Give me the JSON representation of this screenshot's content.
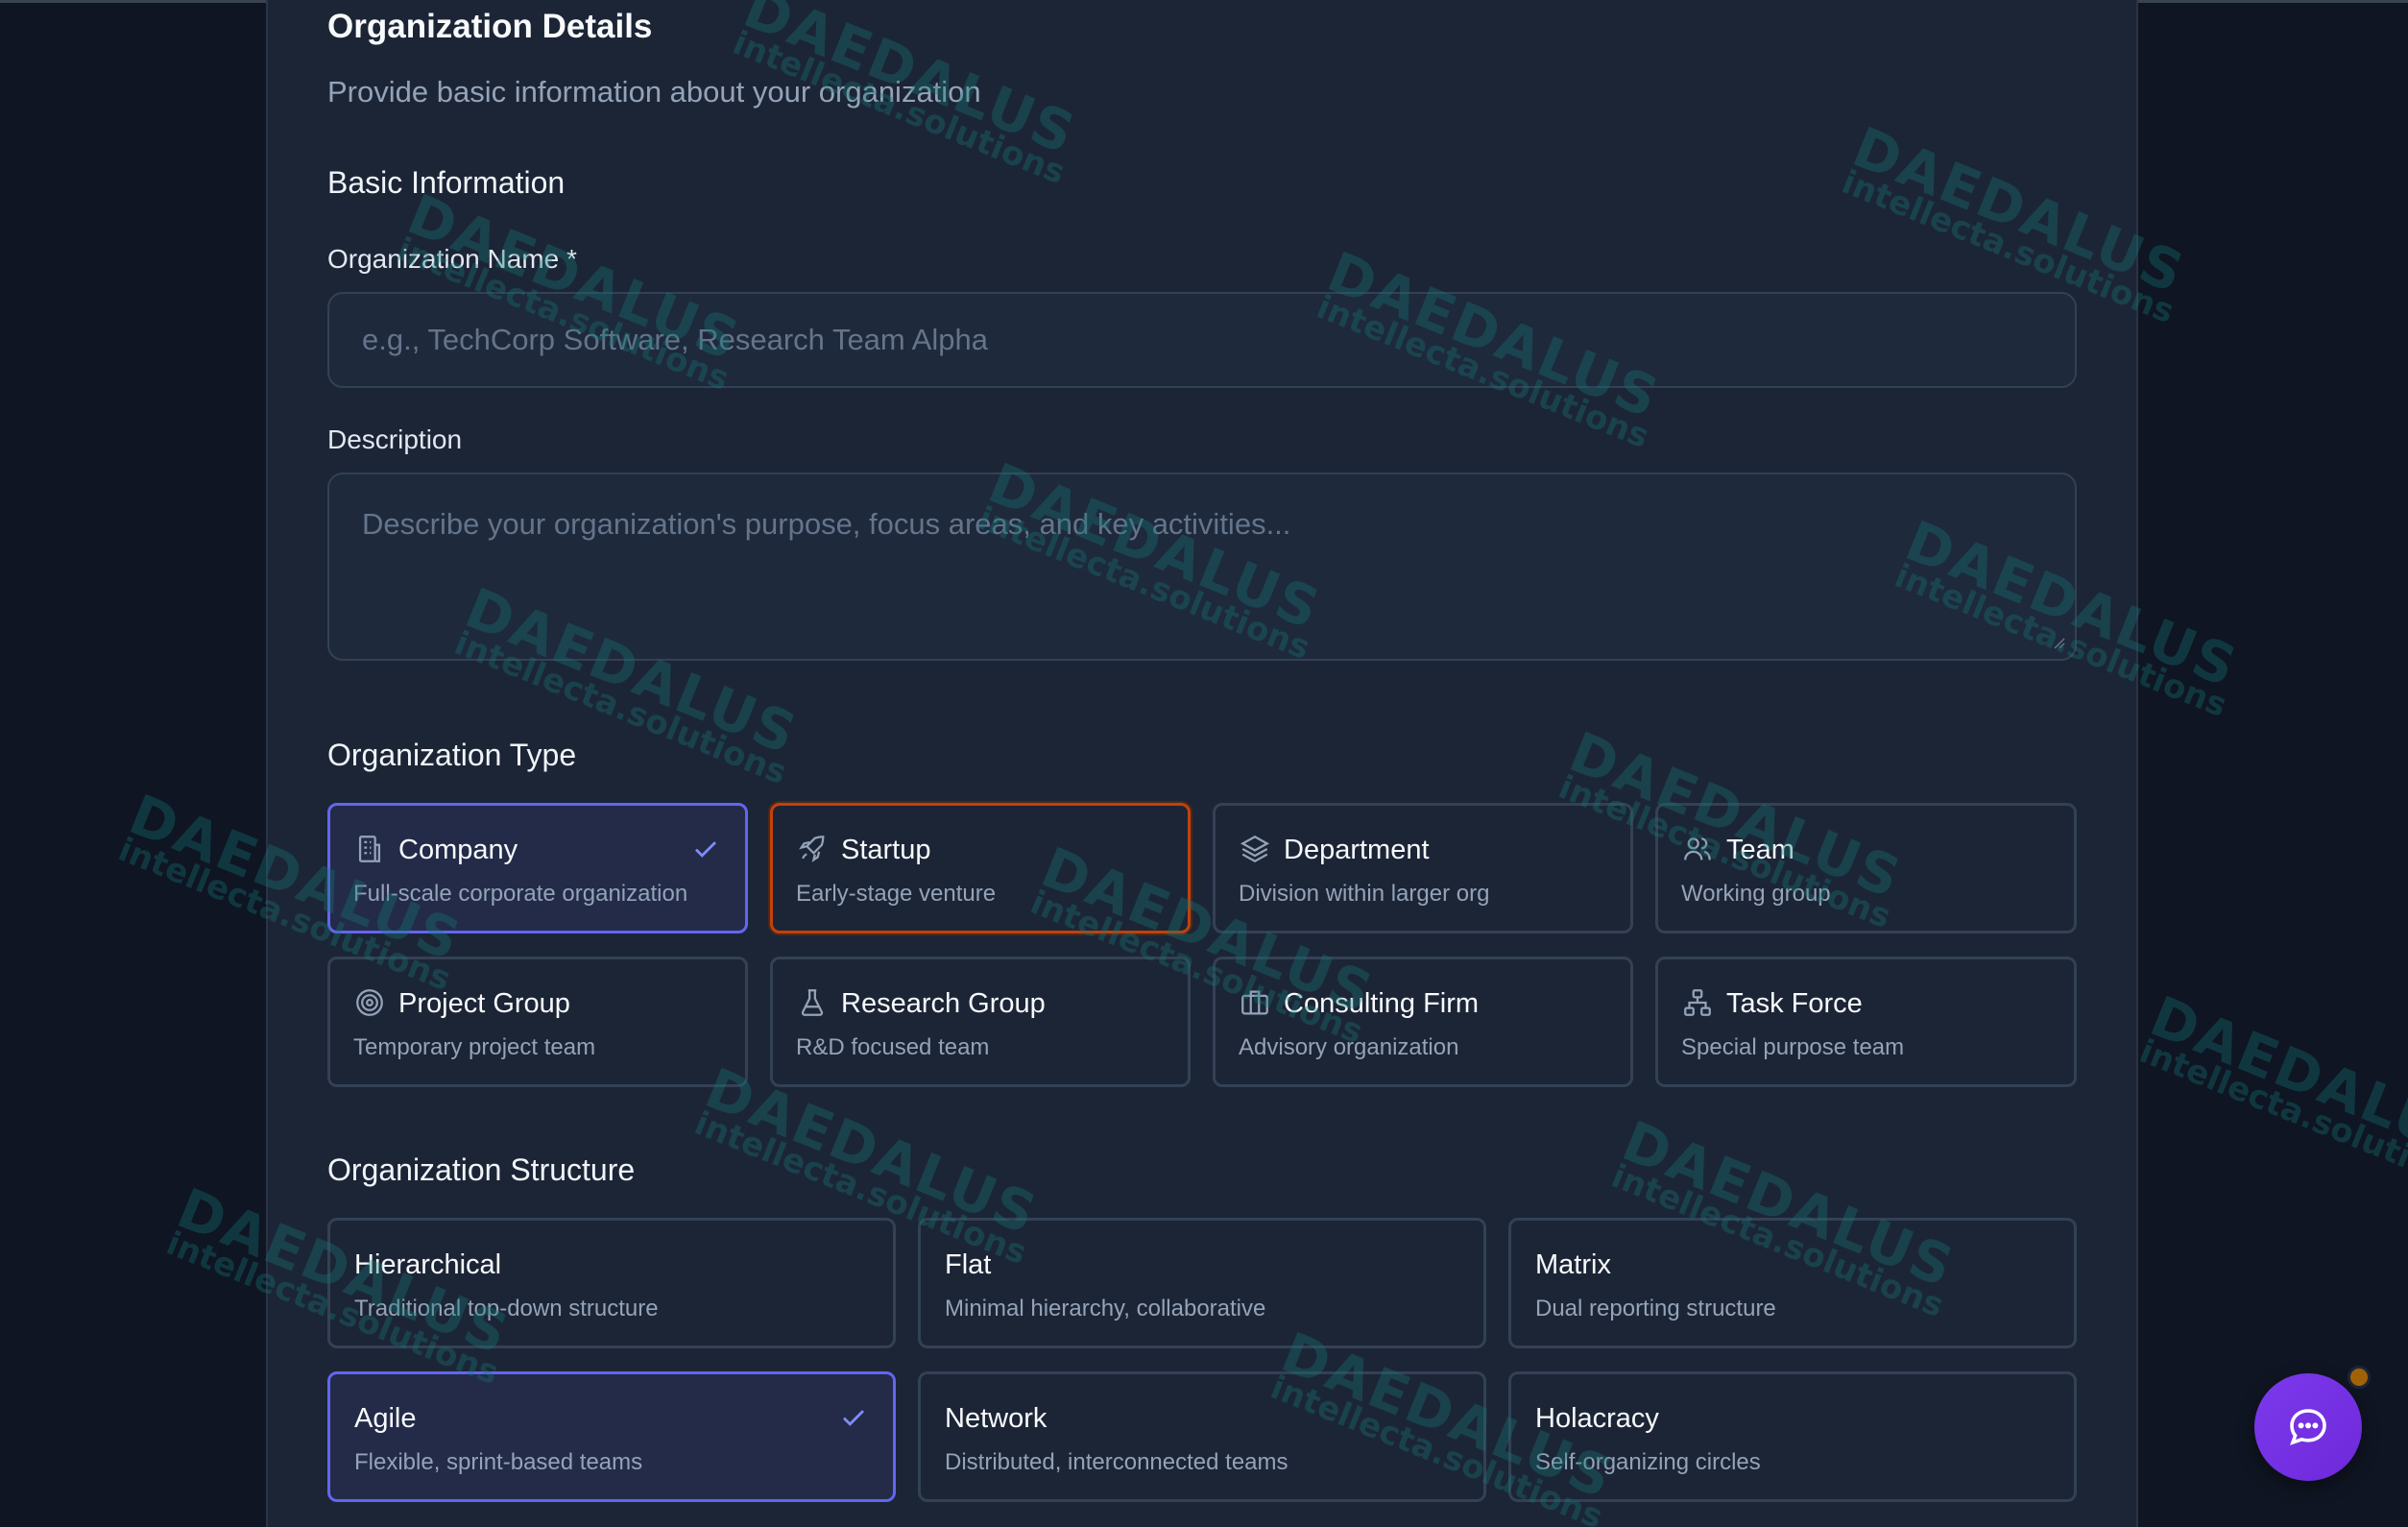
{
  "form": {
    "title": "Organization Details",
    "subtitle": "Provide basic information about your organization",
    "basic_section_title": "Basic Information",
    "org_name_label": "Organization Name *",
    "org_name_placeholder": "e.g., TechCorp Software, Research Team Alpha",
    "org_name_value": "",
    "description_label": "Description",
    "description_placeholder": "Describe your organization's purpose, focus areas, and key activities...",
    "description_value": ""
  },
  "org_type": {
    "section_title": "Organization Type",
    "selected": "Company",
    "options": [
      {
        "title": "Company",
        "desc": "Full-scale corporate organization",
        "icon": "building-icon"
      },
      {
        "title": "Startup",
        "desc": "Early-stage venture",
        "icon": "rocket-icon"
      },
      {
        "title": "Department",
        "desc": "Division within larger org",
        "icon": "layers-icon"
      },
      {
        "title": "Team",
        "desc": "Working group",
        "icon": "users-icon"
      },
      {
        "title": "Project Group",
        "desc": "Temporary project team",
        "icon": "target-icon"
      },
      {
        "title": "Research Group",
        "desc": "R&D focused team",
        "icon": "flask-icon"
      },
      {
        "title": "Consulting Firm",
        "desc": "Advisory organization",
        "icon": "briefcase-icon"
      },
      {
        "title": "Task Force",
        "desc": "Special purpose team",
        "icon": "network-icon"
      }
    ]
  },
  "org_structure": {
    "section_title": "Organization Structure",
    "selected": "Agile",
    "options": [
      {
        "title": "Hierarchical",
        "desc": "Traditional top-down structure"
      },
      {
        "title": "Flat",
        "desc": "Minimal hierarchy, collaborative"
      },
      {
        "title": "Matrix",
        "desc": "Dual reporting structure"
      },
      {
        "title": "Agile",
        "desc": "Flexible, sprint-based teams"
      },
      {
        "title": "Network",
        "desc": "Distributed, interconnected teams"
      },
      {
        "title": "Holacracy",
        "desc": "Self-organizing circles"
      }
    ]
  },
  "watermark": {
    "brand": "DAEDALUS",
    "domain": "intellecta.solutions"
  },
  "colors": {
    "background": "#0f1522",
    "panel": "#1c2536",
    "selected_border": "#6366f1",
    "focus_border": "#c2410c",
    "chat_button": "#7c3aed",
    "notification_dot": "#a16207"
  },
  "chat": {
    "icon": "chat-bubble-icon"
  }
}
